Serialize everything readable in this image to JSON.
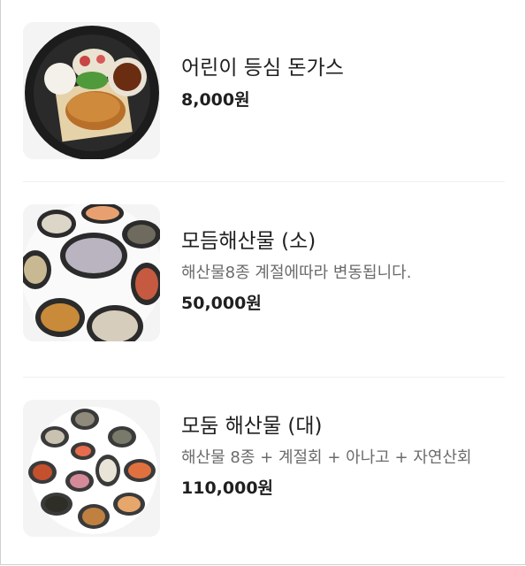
{
  "menu": {
    "items": [
      {
        "name": "어린이 등심 돈가스",
        "description": "",
        "price": "8,000원",
        "image_icon": "pork-cutlet-plate-image"
      },
      {
        "name": "모듬해산물 (소)",
        "description": "해산물8종 계절에따라 변동됩니다.",
        "price": "50,000원",
        "image_icon": "seafood-platter-small-image"
      },
      {
        "name": "모둠 해산물 (대)",
        "description": "해산물 8종 + 계절회 + 아나고 + 자연산회",
        "price": "110,000원",
        "image_icon": "seafood-platter-large-image"
      }
    ]
  }
}
